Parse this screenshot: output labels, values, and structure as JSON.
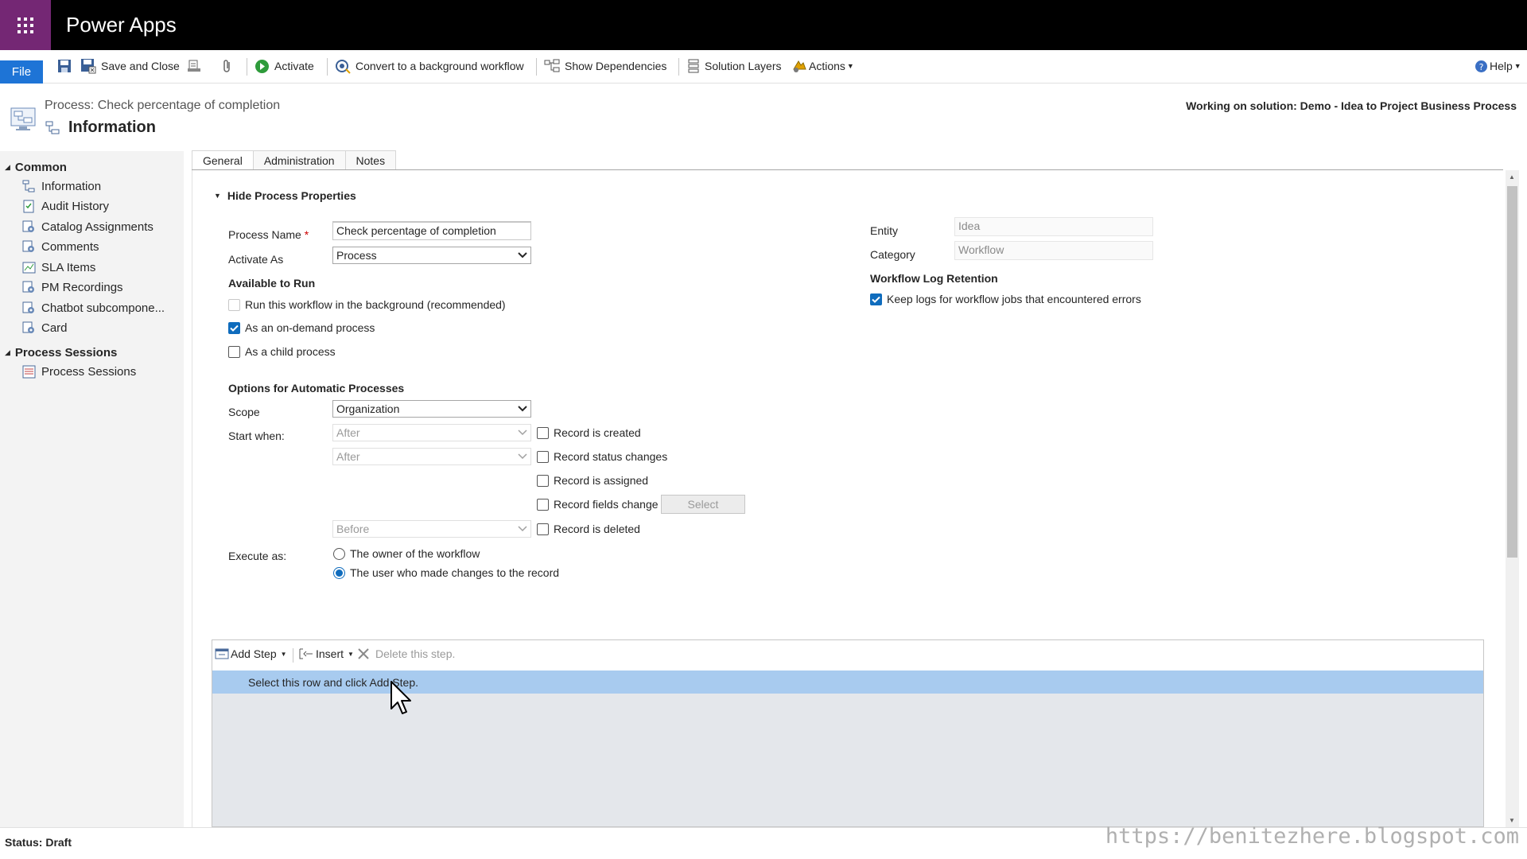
{
  "app": {
    "title": "Power Apps"
  },
  "ribbon": {
    "file": "File",
    "save_close": "Save and Close",
    "activate": "Activate",
    "convert": "Convert to a background workflow",
    "show_dependencies": "Show Dependencies",
    "solution_layers": "Solution Layers",
    "actions": "Actions",
    "help": "Help"
  },
  "header": {
    "subtitle": "Process: Check percentage of completion",
    "title": "Information",
    "solution": "Working on solution: Demo - Idea to Project Business Process"
  },
  "nav": {
    "common": "Common",
    "items": [
      "Information",
      "Audit History",
      "Catalog Assignments",
      "Comments",
      "SLA Items",
      "PM Recordings",
      "Chatbot subcompone...",
      "Card"
    ],
    "process_sessions_group": "Process Sessions",
    "process_sessions_item": "Process Sessions"
  },
  "tabs": [
    "General",
    "Administration",
    "Notes"
  ],
  "form": {
    "hide_props": "Hide Process Properties",
    "process_name_label": "Process Name",
    "required_mark": "*",
    "process_name_value": "Check percentage of completion",
    "activate_as_label": "Activate As",
    "activate_as_value": "Process",
    "available_to_run": "Available to Run",
    "run_background": "Run this workflow in the background (recommended)",
    "on_demand": "As an on-demand process",
    "child_process": "As a child process",
    "options_auto": "Options for Automatic Processes",
    "scope_label": "Scope",
    "scope_value": "Organization",
    "start_when_label": "Start when:",
    "after1": "After",
    "after2": "After",
    "before": "Before",
    "record_created": "Record is created",
    "record_status": "Record status changes",
    "record_assigned": "Record is assigned",
    "record_fields": "Record fields change",
    "select_btn": "Select",
    "record_deleted": "Record is deleted",
    "execute_as_label": "Execute as:",
    "owner": "The owner of the workflow",
    "user_changes": "The user who made changes to the record",
    "entity_label": "Entity",
    "entity_value": "Idea",
    "category_label": "Category",
    "category_value": "Workflow",
    "log_retention": "Workflow Log Retention",
    "keep_logs": "Keep logs for workflow jobs that encountered errors"
  },
  "steps": {
    "add_step": "Add Step",
    "insert": "Insert",
    "delete": "Delete this step.",
    "row_text": "Select this row and click Add Step."
  },
  "status": "Status: Draft",
  "watermark": "https://benitezhere.blogspot.com",
  "colors": {
    "waffle": "#742774",
    "file": "#1e74d6",
    "selected_row": "#a8cbef",
    "checkbox": "#0f6cbd"
  }
}
